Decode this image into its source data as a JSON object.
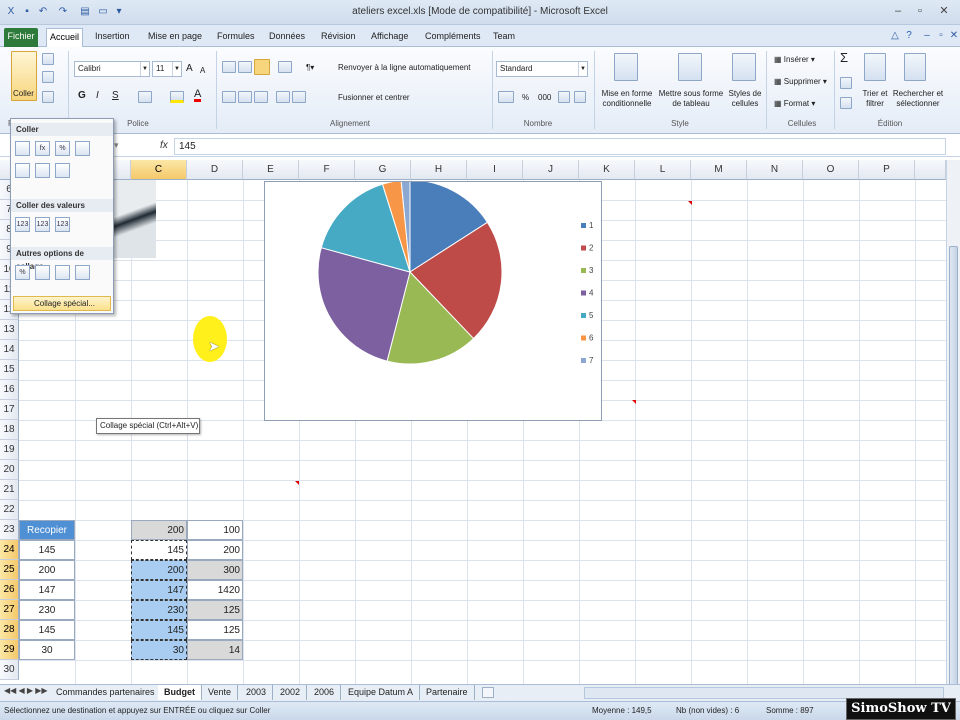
{
  "window": {
    "title": "ateliers excel.xls  [Mode de compatibilité]  -  Microsoft Excel"
  },
  "tabs": [
    {
      "label": "Fichier"
    },
    {
      "label": "Accueil"
    },
    {
      "label": "Insertion"
    },
    {
      "label": "Mise en page"
    },
    {
      "label": "Formules"
    },
    {
      "label": "Données"
    },
    {
      "label": "Révision"
    },
    {
      "label": "Affichage"
    },
    {
      "label": "Compléments"
    },
    {
      "label": "Team"
    }
  ],
  "ribbon": {
    "paste": "Coller",
    "font_name": "Calibri",
    "font_size": "11",
    "bold": "G",
    "italic": "I",
    "underline": "S",
    "wrap": "Renvoyer à la ligne automatiquement",
    "merge": "Fusionner et centrer",
    "number_format": "Standard",
    "pct": "%",
    "thousands": "000",
    "cond_format": "Mise en forme conditionnelle",
    "table_format": "Mettre sous forme de tableau",
    "cell_styles": "Styles de cellules",
    "insert": "Insérer",
    "delete": "Supprimer",
    "format": "Format",
    "sum": "Σ",
    "sort": "Trier et filtrer",
    "find": "Rechercher et sélectionner",
    "groups": {
      "clipboard": "Pr",
      "font": "Police",
      "alignment": "Alignement",
      "number": "Nombre",
      "style": "Style",
      "cells": "Cellules",
      "editing": "Édition"
    }
  },
  "formula_bar": {
    "fx": "fx",
    "value": "145"
  },
  "columns": [
    "C",
    "D",
    "E",
    "F",
    "G",
    "H",
    "I",
    "J",
    "K",
    "L",
    "M",
    "N",
    "O",
    "P"
  ],
  "rows": [
    "6",
    "7",
    "8",
    "9",
    "10",
    "11",
    "12",
    "13",
    "14",
    "15",
    "16",
    "17",
    "18",
    "19",
    "20",
    "21",
    "22",
    "23",
    "24",
    "25",
    "26",
    "27",
    "28",
    "29",
    "30"
  ],
  "cells": {
    "b23": "Recopier",
    "b": [
      "145",
      "200",
      "147",
      "230",
      "145",
      "30"
    ],
    "c23": "200",
    "d23": "100",
    "c": [
      "145",
      "200",
      "147",
      "230",
      "145",
      "30"
    ],
    "d": [
      "200",
      "300",
      "1420",
      "125",
      "125",
      "14"
    ]
  },
  "paste_menu": {
    "h1": "Coller",
    "h2": "Coller des valeurs",
    "h3": "Autres options de collage",
    "special": "Collage spécial...",
    "i1": "fx",
    "i2": "%",
    "i3": "123"
  },
  "tooltip": "Collage spécial (Ctrl+Alt+V)",
  "chart_data": {
    "type": "pie",
    "categories": [
      "1",
      "2",
      "3",
      "4",
      "5",
      "6",
      "7"
    ],
    "values": [
      145,
      200,
      147,
      230,
      145,
      30,
      14
    ],
    "legend_labels": [
      "1",
      "2",
      "3",
      "4",
      "5",
      "6",
      "7"
    ],
    "legend_position": "right",
    "colors": [
      "#4a7ebb",
      "#be4b48",
      "#98b954",
      "#7d60a0",
      "#46aac5",
      "#f79646",
      "#8ba8d3"
    ]
  },
  "sheets": [
    "Commandes partenaires",
    "Budget",
    "Vente",
    "2003",
    "2002",
    "2006",
    "Equipe Datum A",
    "Partenaire"
  ],
  "status": {
    "message": "Sélectionnez une destination et appuyez sur ENTRÉE ou cliquez sur Coller",
    "average": "Moyenne : 149,5",
    "count": "Nb (non vides) : 6",
    "sum": "Somme : 897"
  },
  "watermark": "SimoShow TV"
}
